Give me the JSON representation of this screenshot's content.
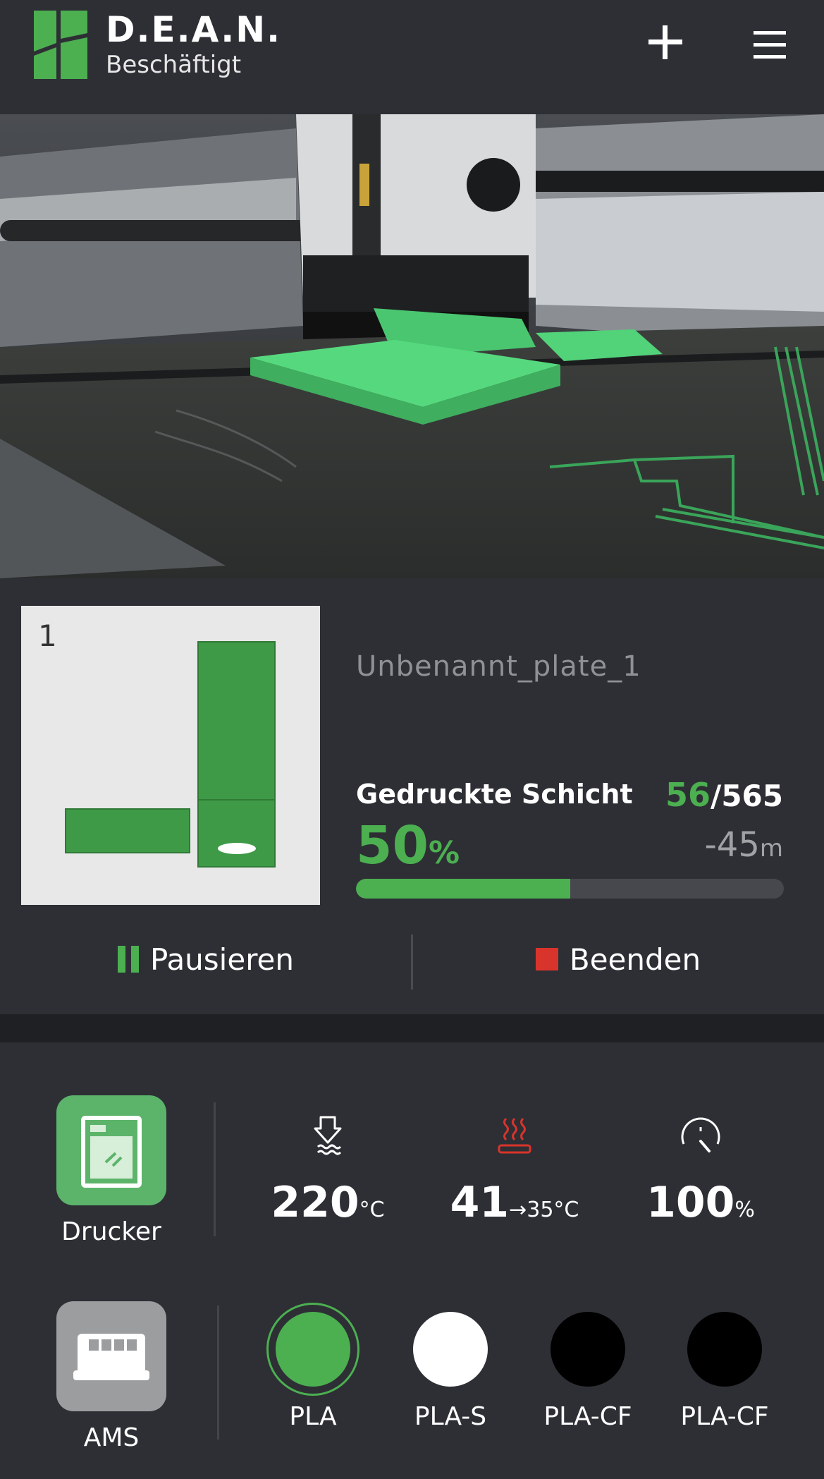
{
  "header": {
    "printer_name": "D.E.A.N.",
    "printer_status": "Beschäftigt",
    "icons": {
      "logo": "bambu-logo-icon",
      "add": "plus-icon",
      "menu": "hamburger-menu-icon"
    }
  },
  "camera": {
    "icon": "camera-feed"
  },
  "job": {
    "plate_number": "1",
    "name": "Unbenannt_plate_1",
    "layer_label": "Gedruckte Schicht",
    "layer_current": "56",
    "layer_total": "/565",
    "progress_value": "50",
    "progress_unit": "%",
    "progress_fraction": 0.5,
    "remaining_value": "-45",
    "remaining_unit": "m",
    "pause_label": "Pausieren",
    "stop_label": "Beenden"
  },
  "status": {
    "printer_tab_label": "Drucker",
    "ams_tab_label": "AMS",
    "nozzle": {
      "value": "220",
      "unit": "°C",
      "icon": "nozzle-temperature-icon"
    },
    "bed": {
      "value": "41",
      "unit": "→35°C",
      "icon": "heatbed-temperature-icon"
    },
    "speed": {
      "value": "100",
      "unit": "%",
      "icon": "speed-gauge-icon"
    },
    "ams_slots": [
      {
        "label": "PLA",
        "color": "#4caf50",
        "active": true
      },
      {
        "label": "PLA-S",
        "color": "#ffffff",
        "active": false
      },
      {
        "label": "PLA-CF",
        "color": "#000000",
        "active": false
      },
      {
        "label": "PLA-CF",
        "color": "#000000",
        "active": false
      }
    ]
  },
  "colors": {
    "accent": "#4caf50",
    "background": "#2d2f35",
    "stop_red": "#d9342b",
    "bed_icon_red": "#d9342b"
  }
}
